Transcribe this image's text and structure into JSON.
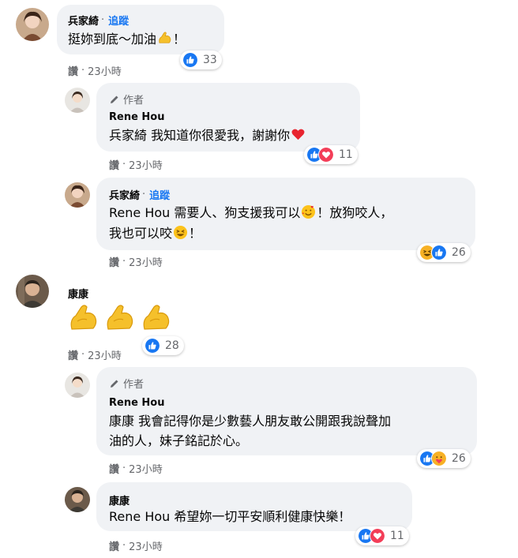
{
  "comments": [
    {
      "name": "兵家綺",
      "follow": "追蹤",
      "text": "挺妳到底～加油",
      "text_end": "！",
      "reply_label": "讚",
      "time": "23小時",
      "reaction_count": "33"
    },
    {
      "author_tag": "作者",
      "name": "Rene Hou",
      "text": "兵家綺 我知道你很愛我，謝謝你",
      "reply_label": "讚",
      "time": "23小時",
      "reaction_count": "11"
    },
    {
      "name": "兵家綺",
      "follow": "追蹤",
      "text_line1_a": "Rene Hou 需要人、狗支援我可以",
      "text_line1_b": "！放狗咬人，",
      "text_line2_a": "我也可以咬",
      "text_line2_b": "！",
      "reply_label": "讚",
      "time": "23小時",
      "reaction_count": "26"
    },
    {
      "name": "康康",
      "reply_label": "讚",
      "time": "23小時",
      "reaction_count": "28"
    },
    {
      "author_tag": "作者",
      "name": "Rene Hou",
      "text_line1": "康康 我會記得你是少數藝人朋友敢公開跟我說聲加",
      "text_line2": "油的人，妹子銘記於心。",
      "reply_label": "讚",
      "time": "23小時",
      "reaction_count": "26"
    },
    {
      "name": "康康",
      "text": "Rene Hou 希望妳一切平安順利健康快樂！",
      "reply_label": "讚",
      "time": "23小時",
      "reaction_count": "11"
    }
  ],
  "separator": "·",
  "colors": {
    "bubble": "#f0f2f5",
    "link": "#1877f2",
    "muted": "#65676b",
    "like": "#1877f2",
    "love": "#f33e58"
  },
  "icons": [
    "like-icon",
    "love-icon",
    "haha-icon",
    "care-icon",
    "flexed-biceps-emoji",
    "pen-icon"
  ]
}
